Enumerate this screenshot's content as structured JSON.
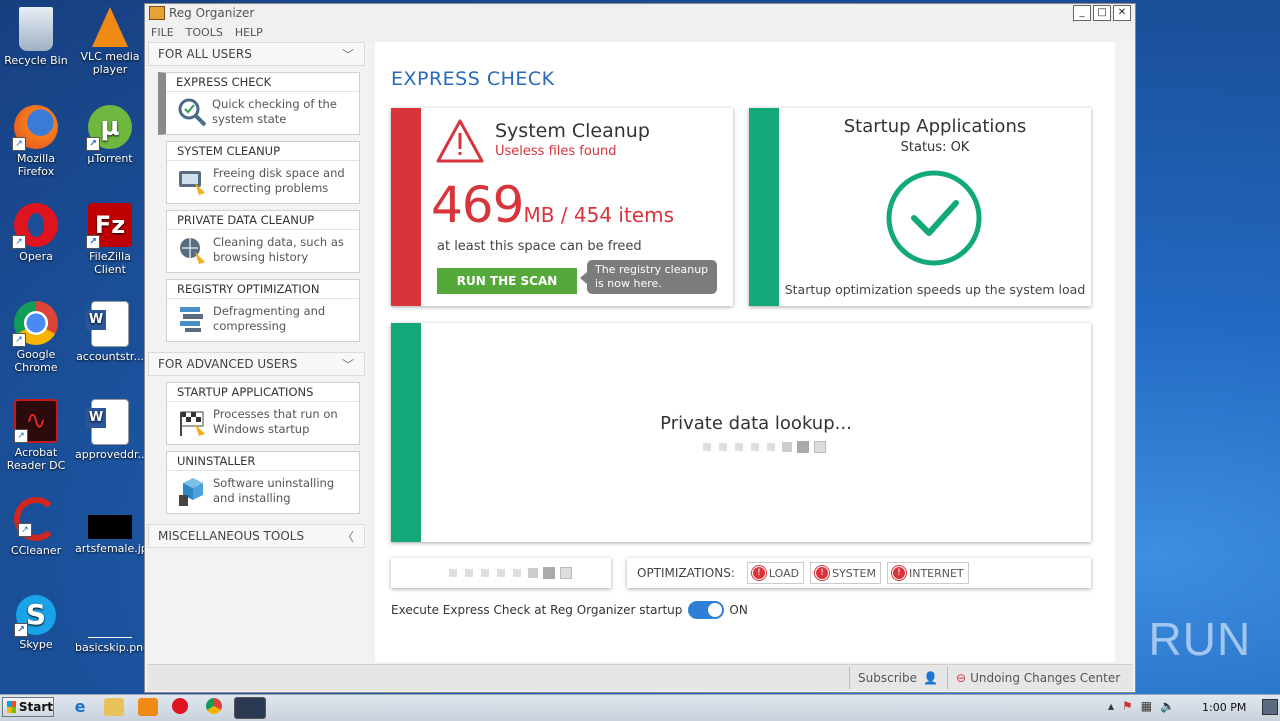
{
  "desktop": {
    "icons": [
      {
        "label": "Recycle Bin",
        "icon": "recycle-bin-icon"
      },
      {
        "label": "VLC media player",
        "icon": "vlc-icon"
      },
      {
        "label": "Mozilla Firefox",
        "icon": "firefox-icon"
      },
      {
        "label": "µTorrent",
        "icon": "utorrent-icon"
      },
      {
        "label": "Opera",
        "icon": "opera-icon"
      },
      {
        "label": "FileZilla Client",
        "icon": "filezilla-icon"
      },
      {
        "label": "Google Chrome",
        "icon": "chrome-icon"
      },
      {
        "label": "accountstr...",
        "icon": "word-document-icon"
      },
      {
        "label": "Acrobat Reader DC",
        "icon": "acrobat-icon"
      },
      {
        "label": "approveddr...",
        "icon": "word-document-icon"
      },
      {
        "label": "CCleaner",
        "icon": "ccleaner-icon"
      },
      {
        "label": "artsfemale.jpg",
        "icon": "image-file-icon"
      },
      {
        "label": "Skype",
        "icon": "skype-icon"
      },
      {
        "label": "basicskip.png",
        "icon": "image-file-icon"
      }
    ],
    "watermark": "ANY RUN"
  },
  "window": {
    "title": "Reg Organizer",
    "menu": [
      "FILE",
      "TOOLS",
      "HELP"
    ]
  },
  "sidebar": {
    "for_all_users": "FOR ALL USERS",
    "for_advanced_users": "FOR ADVANCED USERS",
    "misc_tools": "MISCELLANEOUS TOOLS",
    "all_users_items": [
      {
        "title": "EXPRESS CHECK",
        "desc": "Quick checking of the system state"
      },
      {
        "title": "SYSTEM CLEANUP",
        "desc": "Freeing disk space and correcting problems"
      },
      {
        "title": "PRIVATE DATA CLEANUP",
        "desc": "Cleaning data, such as browsing history"
      },
      {
        "title": "REGISTRY OPTIMIZATION",
        "desc": "Defragmenting and compressing"
      }
    ],
    "advanced_items": [
      {
        "title": "STARTUP APPLICATIONS",
        "desc": "Processes that run on Windows startup"
      },
      {
        "title": "UNINSTALLER",
        "desc": "Software uninstalling and installing"
      }
    ]
  },
  "main": {
    "heading": "EXPRESS CHECK",
    "cleanup": {
      "title": "System Cleanup",
      "subtitle": "Useless files found",
      "size": "469",
      "size_rest": "MB / 454 items",
      "note": "at least this space can be freed",
      "button": "RUN THE SCAN",
      "tooltip": "The registry cleanup is now here."
    },
    "startup": {
      "title": "Startup Applications",
      "status": "Status: OK",
      "note": "Startup optimization speeds up the system load"
    },
    "private": {
      "title": "Private data lookup..."
    },
    "optimizations": {
      "label": "OPTIMIZATIONS:",
      "buttons": [
        "LOAD",
        "SYSTEM",
        "INTERNET"
      ]
    },
    "startup_toggle": {
      "label": "Execute Express Check at Reg Organizer startup",
      "state": "ON"
    }
  },
  "statusbar": {
    "subscribe": "Subscribe",
    "undo": "Undoing Changes Center"
  },
  "taskbar": {
    "start": "Start",
    "clock": "1:00 PM"
  },
  "colors": {
    "red": "#d8343b",
    "green": "#13a87a",
    "button_green": "#54a93a",
    "heading_blue": "#2a6ab8"
  }
}
